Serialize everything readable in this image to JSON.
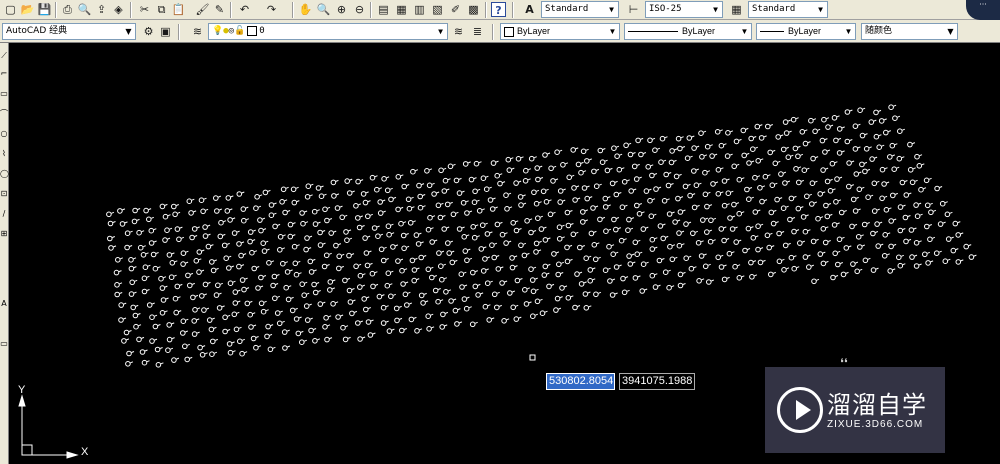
{
  "toolbar1": {
    "buttons": [
      {
        "name": "new-icon",
        "glyph": "▢"
      },
      {
        "name": "open-icon",
        "glyph": "📂"
      },
      {
        "name": "save-icon",
        "glyph": "💾"
      },
      {
        "name": "plot-icon",
        "glyph": "⎙"
      },
      {
        "name": "plot-preview-icon",
        "glyph": "🔍"
      },
      {
        "name": "publish-icon",
        "glyph": "⇪"
      },
      {
        "name": "3d-dwf-icon",
        "glyph": "◈"
      },
      {
        "name": "cut-icon",
        "glyph": "✂"
      },
      {
        "name": "copy-icon",
        "glyph": "⧉"
      },
      {
        "name": "paste-icon",
        "glyph": "📋"
      },
      {
        "name": "match-properties-icon",
        "glyph": "🖌"
      },
      {
        "name": "block-editor-icon",
        "glyph": "✎"
      },
      {
        "name": "undo-icon",
        "glyph": "↶"
      },
      {
        "name": "redo-icon",
        "glyph": "↷"
      },
      {
        "name": "pan-icon",
        "glyph": "✋"
      },
      {
        "name": "zoom-realtime-icon",
        "glyph": "🔍"
      },
      {
        "name": "zoom-window-icon",
        "glyph": "⊕"
      },
      {
        "name": "zoom-previous-icon",
        "glyph": "⊖"
      },
      {
        "name": "properties-icon",
        "glyph": "▤"
      },
      {
        "name": "design-center-icon",
        "glyph": "▦"
      },
      {
        "name": "tool-palettes-icon",
        "glyph": "▥"
      },
      {
        "name": "sheet-set-icon",
        "glyph": "▧"
      },
      {
        "name": "markup-icon",
        "glyph": "✐"
      },
      {
        "name": "quickcalc-icon",
        "glyph": "▩"
      },
      {
        "name": "help-icon",
        "glyph": "?"
      }
    ],
    "text_style_icon": "A",
    "text_style": "Standard",
    "dim_style": "ISO-25",
    "table_style": "Standard",
    "corner_text": "···"
  },
  "toolbar2": {
    "workspace": "AutoCAD 经典",
    "layer": "0",
    "color": "ByLayer",
    "linetype": "ByLayer",
    "lineweight": "ByLayer",
    "plotstyle": "随颜色"
  },
  "left_tools": [
    "⟋",
    "⌐",
    "▭",
    "⌒",
    "○",
    "⌇",
    "◯",
    "⊡",
    "∕",
    "⊞",
    "A",
    "▭"
  ],
  "coordinates": {
    "x": "530802.8054",
    "y": "3941075.1988"
  },
  "ucs": {
    "x_label": "X",
    "y_label": "Y"
  },
  "watermark": {
    "title": "溜溜自学",
    "url": "ZIXUE.3D66.COM"
  },
  "colors": {
    "canvas": "#000000",
    "points": "#ffffff",
    "toolbar": "#ece9d8",
    "selection": "#3169c6"
  }
}
